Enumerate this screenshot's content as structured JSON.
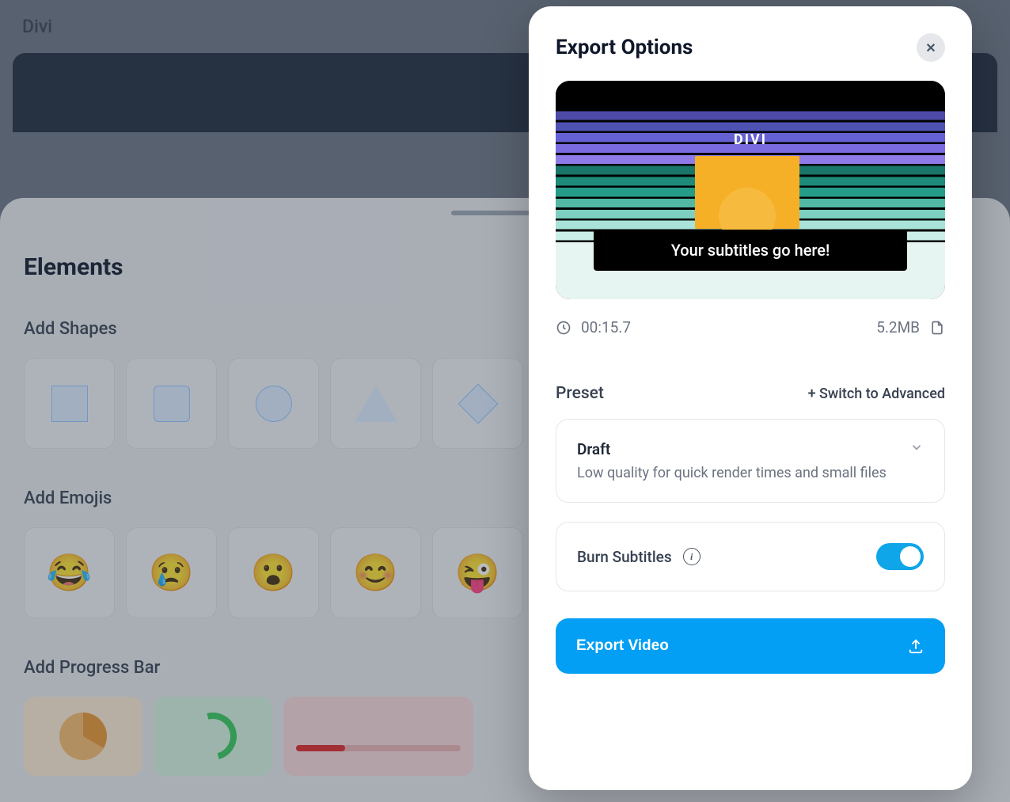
{
  "app": {
    "title": "Divi"
  },
  "elements_panel": {
    "title": "Elements",
    "sections": {
      "shapes_label": "Add Shapes",
      "emojis_label": "Add Emojis",
      "progress_label": "Add Progress Bar"
    },
    "emojis": [
      "😂",
      "😢",
      "😮",
      "😊",
      "😜"
    ]
  },
  "export_modal": {
    "title": "Export Options",
    "preview": {
      "heading": "DIVI",
      "subtitle_text": "Your subtitles go here!"
    },
    "meta": {
      "duration": "00:15.7",
      "filesize": "5.2MB"
    },
    "preset": {
      "label": "Preset",
      "switch_link": "+ Switch to Advanced",
      "selected_name": "Draft",
      "selected_desc": "Low quality for quick render times and small files"
    },
    "burn": {
      "label": "Burn Subtitles",
      "enabled": true
    },
    "export_button": "Export Video"
  }
}
